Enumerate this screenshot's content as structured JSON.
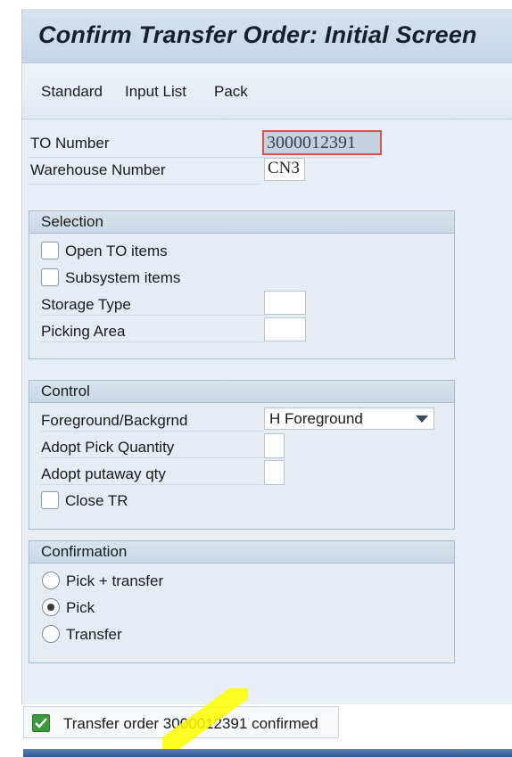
{
  "title": "Confirm Transfer Order: Initial Screen",
  "toolbar": {
    "standard": "Standard",
    "input_list": "Input List",
    "pack": "Pack"
  },
  "header_fields": {
    "to_number_label": "TO Number",
    "to_number_value": "3000012391",
    "warehouse_label": "Warehouse Number",
    "warehouse_value": "CN3"
  },
  "selection": {
    "title": "Selection",
    "open_to_items": "Open TO items",
    "subsystem_items": "Subsystem items",
    "storage_type_label": "Storage Type",
    "storage_type_value": "",
    "picking_area_label": "Picking Area",
    "picking_area_value": ""
  },
  "control": {
    "title": "Control",
    "foreground_label": "Foreground/Backgrnd",
    "foreground_value": "H Foreground",
    "adopt_pick_label": "Adopt Pick Quantity",
    "adopt_putaway_label": "Adopt putaway qty",
    "close_tr_label": "Close TR"
  },
  "confirmation": {
    "title": "Confirmation",
    "options": [
      "Pick + transfer",
      "Pick",
      "Transfer"
    ],
    "selected": "Pick"
  },
  "status": {
    "message": "Transfer order 3000012391 confirmed"
  },
  "colors": {
    "title_bar": "#c4d6e8",
    "focus_border": "#d9534f",
    "ok_green": "#3c9a3c",
    "highlight_yellow": "#ffff00"
  }
}
